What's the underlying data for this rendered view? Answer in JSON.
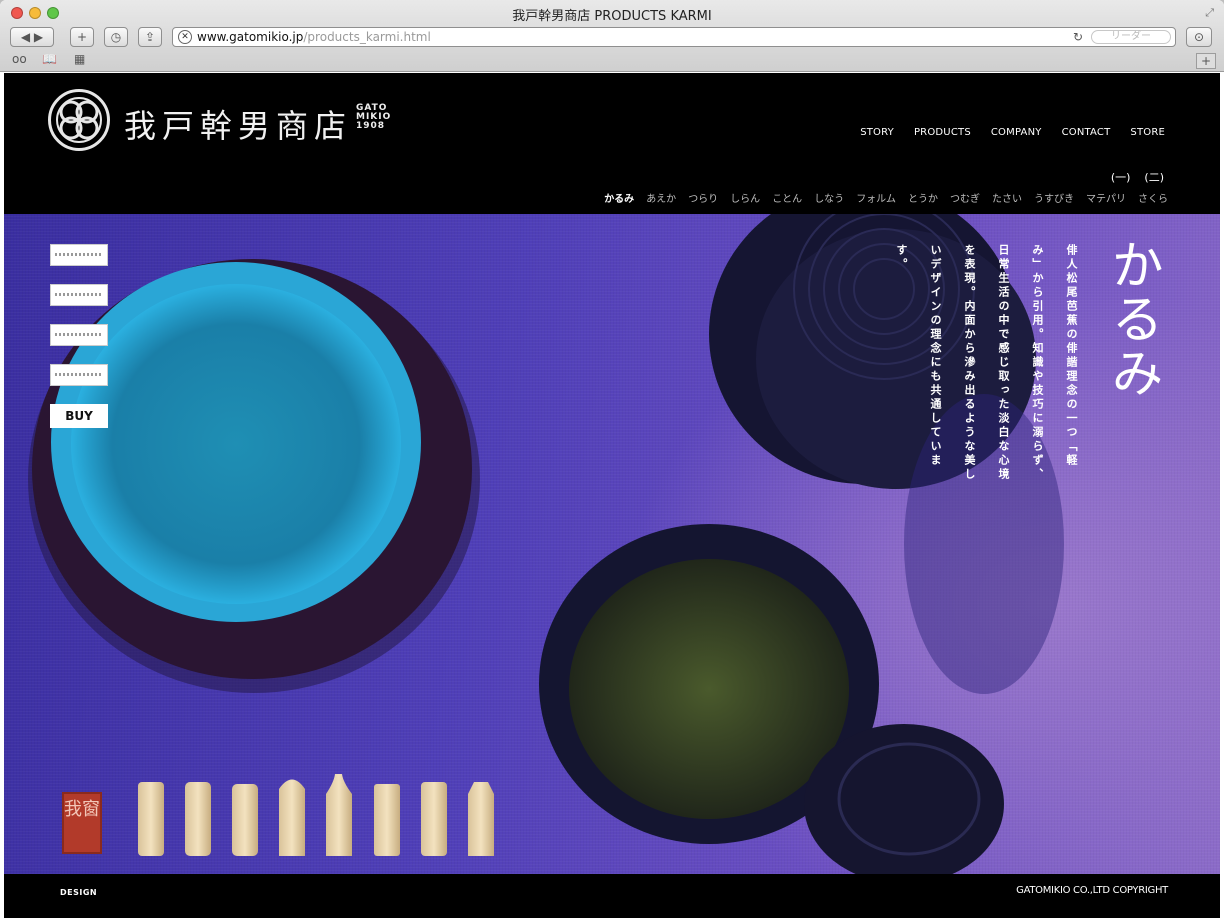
{
  "browser": {
    "window_title": "我戸幹男商店 PRODUCTS KARMI",
    "url_host": "www.gatomikio.jp",
    "url_path": "/products_karmi.html",
    "reader_label": "リーダー",
    "bookmarks": [
      "bookmark-glasses-icon",
      "bookmark-book-icon",
      "bookmark-grid-icon"
    ]
  },
  "header": {
    "logo_kanji": "我戸幹男商店",
    "logo_sub": [
      "GATO",
      "MIKIO",
      "1908"
    ],
    "nav": [
      "STORY",
      "PRODUCTS",
      "COMPANY",
      "CONTACT",
      "STORE"
    ],
    "pager": [
      "(一)",
      "(二)"
    ],
    "subnav": [
      "かるみ",
      "あえか",
      "つらり",
      "しらん",
      "ことん",
      "しなう",
      "フォルム",
      "とうか",
      "つむぎ",
      "たさい",
      "うすびき",
      "マテパリ",
      "さくら"
    ],
    "subnav_active": 0
  },
  "hero": {
    "buy_label": "BUY",
    "title": "かるみ",
    "body": "俳人松尾芭蕉の俳諧理念の一つ「軽み」から引用。知識や技巧に溺らず、日常生活の中で感じ取った淡白な心境を表現。内面から滲み出るような美しいデザインの理念にも共通しています。",
    "seal_text": "我窗"
  },
  "footer": {
    "left": "DESIGN",
    "right": "GATOMIKIO CO.,LTD COPYRIGHT"
  },
  "colors": {
    "background_purple": "#4f3fb8",
    "bowl_turquoise": "#2aa6d6",
    "seal_red": "#b23a2a"
  }
}
